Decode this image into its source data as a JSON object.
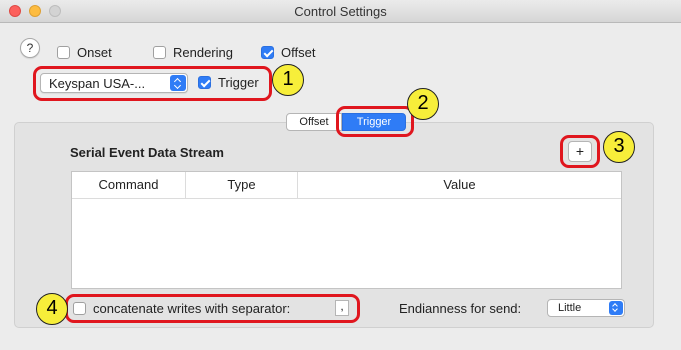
{
  "window": {
    "title": "Control Settings"
  },
  "help": {
    "label": "?"
  },
  "top_checkboxes": [
    {
      "label": "Onset",
      "checked": false
    },
    {
      "label": "Rendering",
      "checked": false
    },
    {
      "label": "Offset",
      "checked": true
    }
  ],
  "device": {
    "selected": "Keyspan USA-...",
    "trigger_label": "Trigger",
    "trigger_checked": true
  },
  "tabs": [
    {
      "label": "Offset",
      "selected": false
    },
    {
      "label": "Trigger",
      "selected": true
    }
  ],
  "panel": {
    "title": "Serial Event Data Stream",
    "add_label": "+",
    "columns": [
      "Command",
      "Type",
      "Value"
    ],
    "rows": []
  },
  "footer": {
    "concatenate_label": "concatenate writes with separator:",
    "concatenate_checked": false,
    "separator_value": ",",
    "endianness_label": "Endianness for send:",
    "endianness_value": "Little"
  },
  "callouts": [
    "1",
    "2",
    "3",
    "4"
  ],
  "colors": {
    "accent": "#2f7cf6",
    "highlight_box": "#e0161e",
    "callout_fill": "#f7ee3a"
  }
}
